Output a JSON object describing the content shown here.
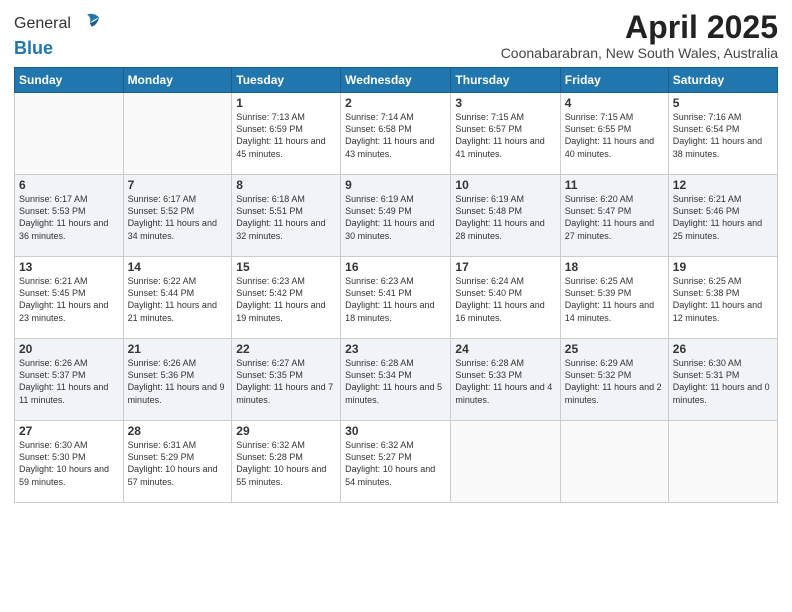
{
  "logo": {
    "general": "General",
    "blue": "Blue"
  },
  "title": "April 2025",
  "location": "Coonabarabran, New South Wales, Australia",
  "days_of_week": [
    "Sunday",
    "Monday",
    "Tuesday",
    "Wednesday",
    "Thursday",
    "Friday",
    "Saturday"
  ],
  "weeks": [
    [
      {
        "day": "",
        "sunrise": "",
        "sunset": "",
        "daylight": ""
      },
      {
        "day": "",
        "sunrise": "",
        "sunset": "",
        "daylight": ""
      },
      {
        "day": "1",
        "sunrise": "Sunrise: 7:13 AM",
        "sunset": "Sunset: 6:59 PM",
        "daylight": "Daylight: 11 hours and 45 minutes."
      },
      {
        "day": "2",
        "sunrise": "Sunrise: 7:14 AM",
        "sunset": "Sunset: 6:58 PM",
        "daylight": "Daylight: 11 hours and 43 minutes."
      },
      {
        "day": "3",
        "sunrise": "Sunrise: 7:15 AM",
        "sunset": "Sunset: 6:57 PM",
        "daylight": "Daylight: 11 hours and 41 minutes."
      },
      {
        "day": "4",
        "sunrise": "Sunrise: 7:15 AM",
        "sunset": "Sunset: 6:55 PM",
        "daylight": "Daylight: 11 hours and 40 minutes."
      },
      {
        "day": "5",
        "sunrise": "Sunrise: 7:16 AM",
        "sunset": "Sunset: 6:54 PM",
        "daylight": "Daylight: 11 hours and 38 minutes."
      }
    ],
    [
      {
        "day": "6",
        "sunrise": "Sunrise: 6:17 AM",
        "sunset": "Sunset: 5:53 PM",
        "daylight": "Daylight: 11 hours and 36 minutes."
      },
      {
        "day": "7",
        "sunrise": "Sunrise: 6:17 AM",
        "sunset": "Sunset: 5:52 PM",
        "daylight": "Daylight: 11 hours and 34 minutes."
      },
      {
        "day": "8",
        "sunrise": "Sunrise: 6:18 AM",
        "sunset": "Sunset: 5:51 PM",
        "daylight": "Daylight: 11 hours and 32 minutes."
      },
      {
        "day": "9",
        "sunrise": "Sunrise: 6:19 AM",
        "sunset": "Sunset: 5:49 PM",
        "daylight": "Daylight: 11 hours and 30 minutes."
      },
      {
        "day": "10",
        "sunrise": "Sunrise: 6:19 AM",
        "sunset": "Sunset: 5:48 PM",
        "daylight": "Daylight: 11 hours and 28 minutes."
      },
      {
        "day": "11",
        "sunrise": "Sunrise: 6:20 AM",
        "sunset": "Sunset: 5:47 PM",
        "daylight": "Daylight: 11 hours and 27 minutes."
      },
      {
        "day": "12",
        "sunrise": "Sunrise: 6:21 AM",
        "sunset": "Sunset: 5:46 PM",
        "daylight": "Daylight: 11 hours and 25 minutes."
      }
    ],
    [
      {
        "day": "13",
        "sunrise": "Sunrise: 6:21 AM",
        "sunset": "Sunset: 5:45 PM",
        "daylight": "Daylight: 11 hours and 23 minutes."
      },
      {
        "day": "14",
        "sunrise": "Sunrise: 6:22 AM",
        "sunset": "Sunset: 5:44 PM",
        "daylight": "Daylight: 11 hours and 21 minutes."
      },
      {
        "day": "15",
        "sunrise": "Sunrise: 6:23 AM",
        "sunset": "Sunset: 5:42 PM",
        "daylight": "Daylight: 11 hours and 19 minutes."
      },
      {
        "day": "16",
        "sunrise": "Sunrise: 6:23 AM",
        "sunset": "Sunset: 5:41 PM",
        "daylight": "Daylight: 11 hours and 18 minutes."
      },
      {
        "day": "17",
        "sunrise": "Sunrise: 6:24 AM",
        "sunset": "Sunset: 5:40 PM",
        "daylight": "Daylight: 11 hours and 16 minutes."
      },
      {
        "day": "18",
        "sunrise": "Sunrise: 6:25 AM",
        "sunset": "Sunset: 5:39 PM",
        "daylight": "Daylight: 11 hours and 14 minutes."
      },
      {
        "day": "19",
        "sunrise": "Sunrise: 6:25 AM",
        "sunset": "Sunset: 5:38 PM",
        "daylight": "Daylight: 11 hours and 12 minutes."
      }
    ],
    [
      {
        "day": "20",
        "sunrise": "Sunrise: 6:26 AM",
        "sunset": "Sunset: 5:37 PM",
        "daylight": "Daylight: 11 hours and 11 minutes."
      },
      {
        "day": "21",
        "sunrise": "Sunrise: 6:26 AM",
        "sunset": "Sunset: 5:36 PM",
        "daylight": "Daylight: 11 hours and 9 minutes."
      },
      {
        "day": "22",
        "sunrise": "Sunrise: 6:27 AM",
        "sunset": "Sunset: 5:35 PM",
        "daylight": "Daylight: 11 hours and 7 minutes."
      },
      {
        "day": "23",
        "sunrise": "Sunrise: 6:28 AM",
        "sunset": "Sunset: 5:34 PM",
        "daylight": "Daylight: 11 hours and 5 minutes."
      },
      {
        "day": "24",
        "sunrise": "Sunrise: 6:28 AM",
        "sunset": "Sunset: 5:33 PM",
        "daylight": "Daylight: 11 hours and 4 minutes."
      },
      {
        "day": "25",
        "sunrise": "Sunrise: 6:29 AM",
        "sunset": "Sunset: 5:32 PM",
        "daylight": "Daylight: 11 hours and 2 minutes."
      },
      {
        "day": "26",
        "sunrise": "Sunrise: 6:30 AM",
        "sunset": "Sunset: 5:31 PM",
        "daylight": "Daylight: 11 hours and 0 minutes."
      }
    ],
    [
      {
        "day": "27",
        "sunrise": "Sunrise: 6:30 AM",
        "sunset": "Sunset: 5:30 PM",
        "daylight": "Daylight: 10 hours and 59 minutes."
      },
      {
        "day": "28",
        "sunrise": "Sunrise: 6:31 AM",
        "sunset": "Sunset: 5:29 PM",
        "daylight": "Daylight: 10 hours and 57 minutes."
      },
      {
        "day": "29",
        "sunrise": "Sunrise: 6:32 AM",
        "sunset": "Sunset: 5:28 PM",
        "daylight": "Daylight: 10 hours and 55 minutes."
      },
      {
        "day": "30",
        "sunrise": "Sunrise: 6:32 AM",
        "sunset": "Sunset: 5:27 PM",
        "daylight": "Daylight: 10 hours and 54 minutes."
      },
      {
        "day": "",
        "sunrise": "",
        "sunset": "",
        "daylight": ""
      },
      {
        "day": "",
        "sunrise": "",
        "sunset": "",
        "daylight": ""
      },
      {
        "day": "",
        "sunrise": "",
        "sunset": "",
        "daylight": ""
      }
    ]
  ]
}
